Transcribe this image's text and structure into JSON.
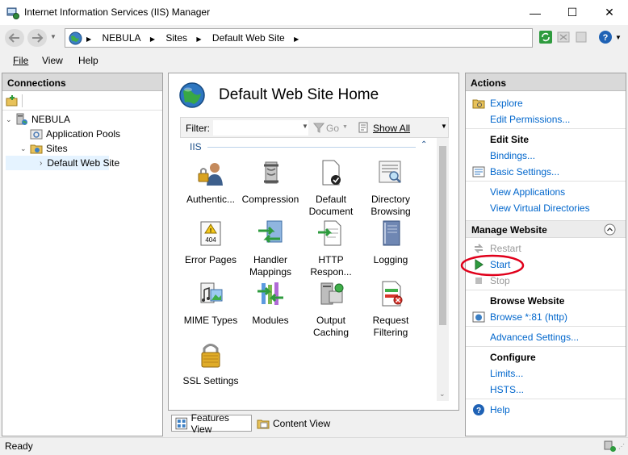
{
  "window": {
    "title": "Internet Information Services (IIS) Manager",
    "minimize": "—",
    "maximize": "☐",
    "close": "✕"
  },
  "address": {
    "crumbs": [
      "NEBULA",
      "Sites",
      "Default Web Site"
    ]
  },
  "menu": {
    "file": "File",
    "view": "View",
    "help": "Help"
  },
  "connections": {
    "header": "Connections",
    "tree": [
      {
        "label": "NEBULA",
        "level": 0,
        "expanded": true
      },
      {
        "label": "Application Pools",
        "level": 1
      },
      {
        "label": "Sites",
        "level": 1,
        "expanded": true
      },
      {
        "label": "Default Web Site",
        "level": 2,
        "selected": true
      }
    ]
  },
  "center": {
    "title": "Default Web Site Home",
    "filter_label": "Filter:",
    "go_label": "Go",
    "show_all_label": "Show All",
    "group_label": "IIS",
    "features": [
      {
        "label": "Authentic...",
        "icon": "authentication-icon"
      },
      {
        "label": "Compression",
        "icon": "compression-icon"
      },
      {
        "label": "Default\nDocument",
        "icon": "default-document-icon"
      },
      {
        "label": "Directory\nBrowsing",
        "icon": "directory-browsing-icon"
      },
      {
        "label": "Error Pages",
        "icon": "error-pages-icon"
      },
      {
        "label": "Handler\nMappings",
        "icon": "handler-mappings-icon"
      },
      {
        "label": "HTTP\nRespon...",
        "icon": "http-response-icon"
      },
      {
        "label": "Logging",
        "icon": "logging-icon"
      },
      {
        "label": "MIME Types",
        "icon": "mime-types-icon"
      },
      {
        "label": "Modules",
        "icon": "modules-icon"
      },
      {
        "label": "Output\nCaching",
        "icon": "output-caching-icon"
      },
      {
        "label": "Request\nFiltering",
        "icon": "request-filtering-icon"
      },
      {
        "label": "SSL Settings",
        "icon": "ssl-settings-icon"
      }
    ],
    "error_badge": "404"
  },
  "tabs": {
    "features_view": "Features View",
    "content_view": "Content View"
  },
  "actions": {
    "header": "Actions",
    "explore": "Explore",
    "edit_permissions": "Edit Permissions...",
    "edit_site": "Edit Site",
    "bindings": "Bindings...",
    "basic_settings": "Basic Settings...",
    "view_applications": "View Applications",
    "view_virtual_directories": "View Virtual Directories",
    "manage_website": "Manage Website",
    "restart": "Restart",
    "start": "Start",
    "stop": "Stop",
    "browse_website": "Browse Website",
    "browse_81": "Browse *:81 (http)",
    "advanced_settings": "Advanced Settings...",
    "configure": "Configure",
    "limits": "Limits...",
    "hsts": "HSTS...",
    "help": "Help"
  },
  "status": {
    "text": "Ready"
  },
  "colors": {
    "link": "#0066cc",
    "annotation": "#e0001b"
  }
}
